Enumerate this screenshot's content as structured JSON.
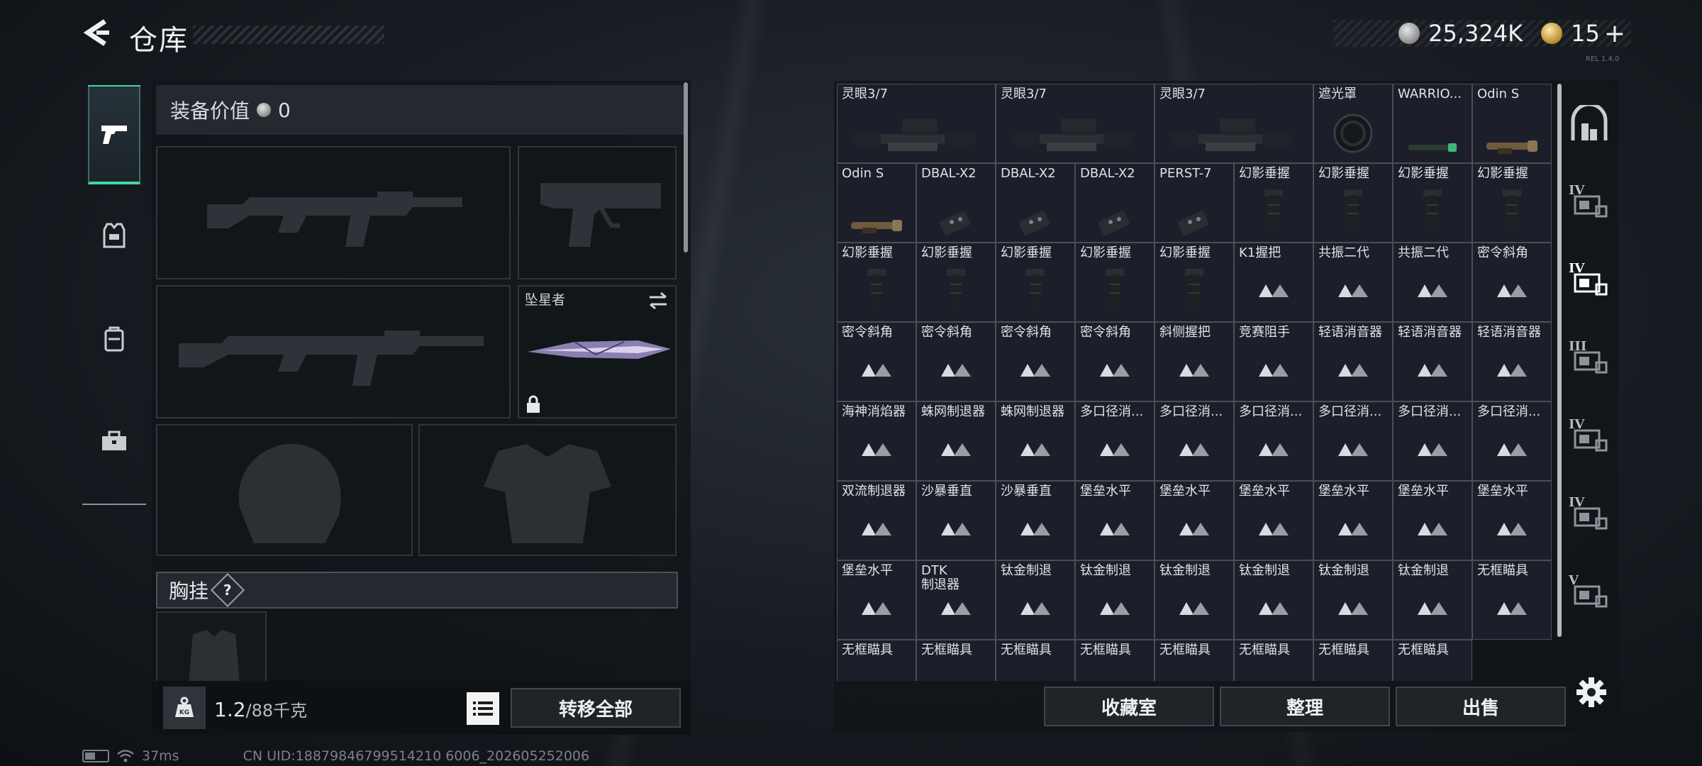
{
  "header": {
    "title": "仓库",
    "currency": {
      "silver_value": "25,324K",
      "gold_value": "15",
      "gold_plus": "+"
    },
    "version_tag": "REL 1.4.0"
  },
  "loadout": {
    "equip_value_label": "装备价值",
    "equip_value": "0",
    "melee_slot_label": "坠星者",
    "chest_rig_label": "胸挂",
    "chest_rig_help": "?",
    "weight_current": "1.2",
    "weight_max": "/88千克",
    "transfer_all_label": "转移全部"
  },
  "status_bar": {
    "ping": "37ms",
    "uid": "CN UID:18879846799514210 6006_202605252006"
  },
  "storage": {
    "items": [
      {
        "name": "灵眼3/7",
        "type": "scope",
        "wide": true
      },
      {
        "name": "灵眼3/7",
        "type": "scope",
        "wide": true
      },
      {
        "name": "灵眼3/7",
        "type": "scope",
        "wide": true
      },
      {
        "name": "遮光罩",
        "type": "hood"
      },
      {
        "name": "WARRIO...",
        "type": "flashlight-green"
      },
      {
        "name": "Odin S",
        "type": "flashlight"
      },
      {
        "name": "Odin S",
        "type": "flashlight"
      },
      {
        "name": "DBAL-X2",
        "type": "laser"
      },
      {
        "name": "DBAL-X2",
        "type": "laser"
      },
      {
        "name": "DBAL-X2",
        "type": "laser"
      },
      {
        "name": "PERST-7",
        "type": "laser"
      },
      {
        "name": "幻影垂握",
        "type": "grip"
      },
      {
        "name": "幻影垂握",
        "type": "grip"
      },
      {
        "name": "幻影垂握",
        "type": "grip"
      },
      {
        "name": "幻影垂握",
        "type": "grip"
      },
      {
        "name": "幻影垂握",
        "type": "grip"
      },
      {
        "name": "幻影垂握",
        "type": "grip"
      },
      {
        "name": "幻影垂握",
        "type": "grip"
      },
      {
        "name": "幻影垂握",
        "type": "grip"
      },
      {
        "name": "幻影垂握",
        "type": "grip"
      },
      {
        "name": "K1握把",
        "type": "placeholder"
      },
      {
        "name": "共振二代",
        "type": "placeholder"
      },
      {
        "name": "共振二代",
        "type": "placeholder"
      },
      {
        "name": "密令斜角",
        "type": "placeholder"
      },
      {
        "name": "密令斜角",
        "type": "placeholder"
      },
      {
        "name": "密令斜角",
        "type": "placeholder"
      },
      {
        "name": "密令斜角",
        "type": "placeholder"
      },
      {
        "name": "密令斜角",
        "type": "placeholder"
      },
      {
        "name": "斜侧握把",
        "type": "placeholder"
      },
      {
        "name": "竞赛阻手",
        "type": "placeholder"
      },
      {
        "name": "轻语消音器",
        "type": "placeholder"
      },
      {
        "name": "轻语消音器",
        "type": "placeholder"
      },
      {
        "name": "轻语消音器",
        "type": "placeholder"
      },
      {
        "name": "海神消焰器",
        "type": "placeholder"
      },
      {
        "name": "蛛网制退器",
        "type": "placeholder"
      },
      {
        "name": "蛛网制退器",
        "type": "placeholder"
      },
      {
        "name": "多口径消...",
        "type": "placeholder"
      },
      {
        "name": "多口径消...",
        "type": "placeholder"
      },
      {
        "name": "多口径消...",
        "type": "placeholder"
      },
      {
        "name": "多口径消...",
        "type": "placeholder"
      },
      {
        "name": "多口径消...",
        "type": "placeholder"
      },
      {
        "name": "多口径消...",
        "type": "placeholder"
      },
      {
        "name": "双流制退器",
        "type": "placeholder"
      },
      {
        "name": "沙暴垂直",
        "type": "placeholder"
      },
      {
        "name": "沙暴垂直",
        "type": "placeholder"
      },
      {
        "name": "堡垒水平",
        "type": "placeholder"
      },
      {
        "name": "堡垒水平",
        "type": "placeholder"
      },
      {
        "name": "堡垒水平",
        "type": "placeholder"
      },
      {
        "name": "堡垒水平",
        "type": "placeholder"
      },
      {
        "name": "堡垒水平",
        "type": "placeholder"
      },
      {
        "name": "堡垒水平",
        "type": "placeholder"
      },
      {
        "name": "堡垒水平",
        "type": "placeholder"
      },
      {
        "name": "DTK\n制退器",
        "type": "placeholder"
      },
      {
        "name": "钛金制退",
        "type": "placeholder"
      },
      {
        "name": "钛金制退",
        "type": "placeholder"
      },
      {
        "name": "钛金制退",
        "type": "placeholder"
      },
      {
        "name": "钛金制退",
        "type": "placeholder"
      },
      {
        "name": "钛金制退",
        "type": "placeholder"
      },
      {
        "name": "钛金制退",
        "type": "placeholder"
      },
      {
        "name": "无框瞄具",
        "type": "placeholder"
      },
      {
        "name": "无框瞄具",
        "type": "placeholder"
      },
      {
        "name": "无框瞄具",
        "type": "placeholder"
      },
      {
        "name": "无框瞄具",
        "type": "placeholder"
      },
      {
        "name": "无框瞄具",
        "type": "placeholder"
      },
      {
        "name": "无框瞄具",
        "type": "placeholder"
      },
      {
        "name": "无框瞄具",
        "type": "placeholder"
      },
      {
        "name": "无框瞄具",
        "type": "placeholder"
      },
      {
        "name": "无框瞄具",
        "type": "placeholder"
      }
    ],
    "buttons": {
      "collection": "收藏室",
      "organize": "整理",
      "sell": "出售"
    },
    "categories": [
      {
        "tier": "",
        "icon": "all-storage-icon"
      },
      {
        "tier": "IV",
        "icon": "tier4-case-icon"
      },
      {
        "tier": "IV",
        "icon": "tier4-key-icon",
        "active": true
      },
      {
        "tier": "III",
        "icon": "tier3-key-icon"
      },
      {
        "tier": "IV",
        "icon": "tier4-case-icon"
      },
      {
        "tier": "IV",
        "icon": "tier4-card-icon"
      },
      {
        "tier": "V",
        "icon": "tier5-card-icon"
      }
    ]
  },
  "colors": {
    "accent": "#41d6a3",
    "cell_bg": "#1c1e2a",
    "panel": "#101418"
  }
}
